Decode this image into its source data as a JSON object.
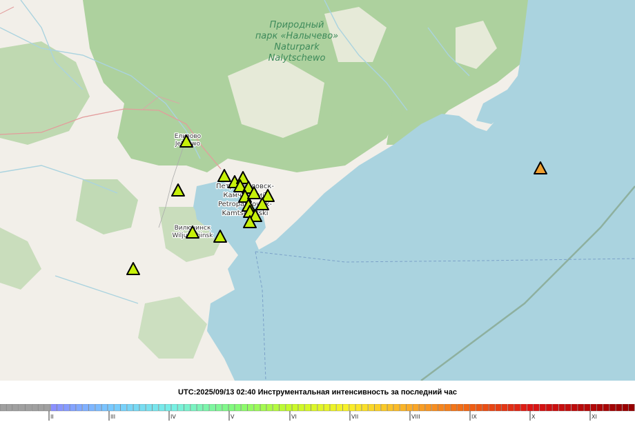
{
  "map": {
    "park_label_lines": [
      "Природный",
      "парк «Налычево»",
      "Naturpark",
      "Nalytschewo"
    ],
    "cities": [
      {
        "name": "elizovo",
        "lines": [
          "Елизово",
          "Jelisowo"
        ]
      },
      {
        "name": "petropavlovsk",
        "lines": [
          "Петропавловск-",
          "Камчатский",
          "Petropawlowsk-",
          "Kamtschatski"
        ]
      },
      {
        "name": "vilyuchinsk",
        "lines": [
          "Вилючинск",
          "Wiljutschinsk"
        ]
      }
    ],
    "stations": [
      {
        "color": "#c6f00a",
        "lat_lon": "53.19,158.38"
      },
      {
        "color": "#c6f00a"
      },
      {
        "color": "#c6f00a"
      },
      {
        "color": "#c6f00a"
      },
      {
        "color": "#c6f00a"
      },
      {
        "color": "#c6f00a"
      },
      {
        "color": "#c6f00a"
      },
      {
        "color": "#c6f00a"
      },
      {
        "color": "#c6f00a"
      },
      {
        "color": "#c6f00a"
      },
      {
        "color": "#c6f00a"
      },
      {
        "color": "#c6f00a"
      },
      {
        "color": "#c6f00a"
      },
      {
        "color": "#c6f00a"
      },
      {
        "color": "#c6f00a"
      },
      {
        "color": "#c6f00a"
      },
      {
        "color": "#c6f00a"
      },
      {
        "color": "#c6f00a"
      },
      {
        "color": "#f0a030"
      }
    ],
    "colors": {
      "sea": "#aad3df",
      "land": "#f2efe9",
      "forest": "#add19e",
      "station_low": "#c6f00a",
      "station_high": "#f0a030"
    }
  },
  "caption": "UTC:2025/09/13 02:40 Инструментальная интенсивность за последний час",
  "scale": {
    "labels": [
      "II",
      "III",
      "IV",
      "V",
      "VI",
      "VII",
      "VIII",
      "IX",
      "X",
      "XI"
    ]
  }
}
